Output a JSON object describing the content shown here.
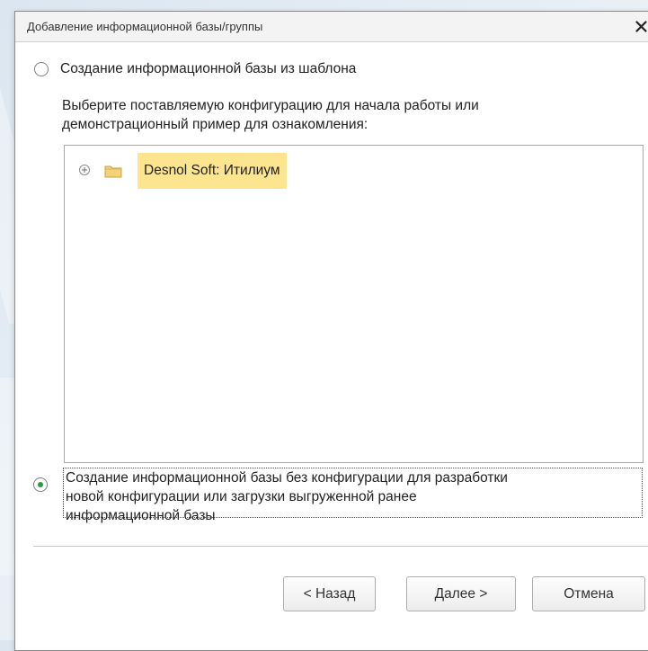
{
  "dialog": {
    "title": "Добавление информационной базы/группы",
    "close_symbol": "✕"
  },
  "option_template": {
    "label": "Создание информационной базы из шаблона",
    "selected": false,
    "description_lines": [
      "Выберите поставляемую конфигурацию для начала работы или",
      "демонстрационный пример для ознакомления:"
    ]
  },
  "tree": {
    "items": [
      {
        "label": "Desnol Soft: Итилиум",
        "icon": "folder-icon",
        "expander": "plus-expand-icon",
        "highlighted": true
      }
    ]
  },
  "option_empty": {
    "selected": true,
    "label_lines": [
      "Создание информационной базы без конфигурации для разработки",
      "новой конфигурации или загрузки выгруженной ранее",
      "информационной базы"
    ]
  },
  "buttons": {
    "back": "< Назад",
    "next": "Далее >",
    "cancel": "Отмена"
  },
  "colors": {
    "selection_highlight": "#fce58e",
    "radio_selected": "#2b9a3a",
    "folder": "#e8c15a"
  }
}
